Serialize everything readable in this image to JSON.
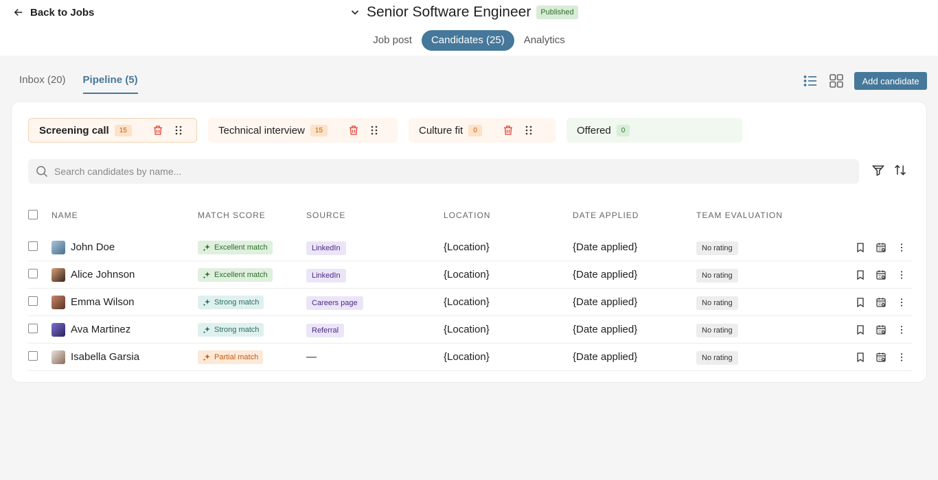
{
  "header": {
    "back_label": "Back to Jobs",
    "job_title": "Senior Software Engineer",
    "status_badge": "Published",
    "tabs": [
      {
        "label": "Job post",
        "active": false
      },
      {
        "label": "Candidates (25)",
        "active": true
      },
      {
        "label": "Analytics",
        "active": false
      }
    ]
  },
  "subtabs": [
    {
      "label": "Inbox (20)",
      "active": false
    },
    {
      "label": "Pipeline (5)",
      "active": true
    }
  ],
  "toolbar": {
    "add_candidate_label": "Add candidate",
    "view_icons": [
      "list-view-icon",
      "grid-view-icon"
    ]
  },
  "stages": [
    {
      "name": "Screening call",
      "count": "15",
      "active": true
    },
    {
      "name": "Technical interview",
      "count": "15",
      "active": false
    },
    {
      "name": "Culture fit",
      "count": "0",
      "active": false
    },
    {
      "name": "Offered",
      "count": "0",
      "active": false
    }
  ],
  "search": {
    "placeholder": "Search candidates by name..."
  },
  "table": {
    "columns": [
      "NAME",
      "MATCH SCORE",
      "SOURCE",
      "LOCATION",
      "DATE APPLIED",
      "TEAM EVALUATION"
    ],
    "rows": [
      {
        "name": "John Doe",
        "match": "Excellent match",
        "match_level": "excellent",
        "source": "LinkedIn",
        "location": "{Location}",
        "date": "{Date applied}",
        "evaluation": "No rating"
      },
      {
        "name": "Alice Johnson",
        "match": "Excellent match",
        "match_level": "excellent",
        "source": "LinkedIn",
        "location": "{Location}",
        "date": "{Date applied}",
        "evaluation": "No rating"
      },
      {
        "name": "Emma Wilson",
        "match": "Strong match",
        "match_level": "strong",
        "source": "Careers page",
        "location": "{Location}",
        "date": "{Date applied}",
        "evaluation": "No rating"
      },
      {
        "name": "Ava Martinez",
        "match": "Strong match",
        "match_level": "strong",
        "source": "Referral",
        "location": "{Location}",
        "date": "{Date applied}",
        "evaluation": "No rating"
      },
      {
        "name": "Isabella Garsia",
        "match": "Partial match",
        "match_level": "partial",
        "source": "—",
        "location": "{Location}",
        "date": "{Date applied}",
        "evaluation": "No rating"
      }
    ]
  },
  "colors": {
    "accent": "#45789a",
    "excellent": "#2f6d2b",
    "strong": "#2a6c64",
    "partial": "#c65a10",
    "delete": "#e0443a"
  }
}
